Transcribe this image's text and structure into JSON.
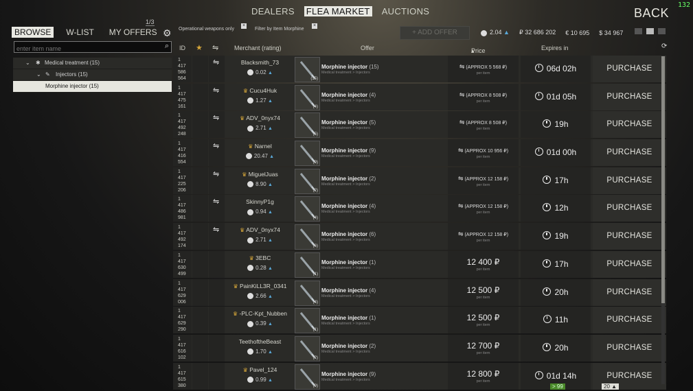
{
  "overlay": {
    "fps": "132"
  },
  "nav": {
    "tabs": [
      {
        "label": "DEALERS"
      },
      {
        "label": "FLEA MARKET"
      },
      {
        "label": "AUCTIONS"
      }
    ],
    "back_label": "BACK"
  },
  "left_tabs": {
    "browse": "BROWSE",
    "wlist": "W-LIST",
    "my_offers": "MY OFFERS",
    "page_count": "1/3"
  },
  "filters": {
    "operational": "Operational weapons only",
    "morphine": "Filter by Item Morphine"
  },
  "add_offer": "+ ADD OFFER",
  "balance": {
    "rating": "2.04",
    "roubles": "₽ 32 686 202",
    "euros": "€ 10 695",
    "dollars": "$ 34 967"
  },
  "search": {
    "placeholder": "enter item name"
  },
  "tree": {
    "medical": "Medical treatment (15)",
    "injectors": "Injectors (15)",
    "morphine": "Morphine injector (15)"
  },
  "headers": {
    "id": "ID",
    "merchant": "Merchant (rating)",
    "offer": "Offer",
    "price": "Price",
    "expires": "Expires in"
  },
  "offer_category": "Medical treatment > Injectors",
  "per_item": "per item",
  "purchase_label": "PURCHASE",
  "rows": [
    {
      "id": [
        "1",
        "417",
        "586",
        "564"
      ],
      "swap": true,
      "crown": false,
      "merchant": "Blacksmith_73",
      "rating": "0.02",
      "item": "Morphine injector",
      "count": "(15)",
      "price": "(APPROX 5 568 ₽)",
      "barter": true,
      "expires": "06d 02h"
    },
    {
      "id": [
        "1",
        "417",
        "475",
        "161"
      ],
      "swap": true,
      "crown": true,
      "merchant": "Cucu4Huk",
      "rating": "1.27",
      "item": "Morphine injector",
      "count": "(4)",
      "price": "(APPROX 8 508 ₽)",
      "barter": true,
      "expires": "01d 05h"
    },
    {
      "id": [
        "1",
        "417",
        "492",
        "248"
      ],
      "swap": true,
      "crown": true,
      "merchant": "ADV_0nyx74",
      "rating": "2.71",
      "item": "Morphine injector",
      "count": "(5)",
      "price": "(APPROX 8 508 ₽)",
      "barter": true,
      "expires": "19h"
    },
    {
      "id": [
        "1",
        "417",
        "416",
        "554"
      ],
      "swap": true,
      "crown": true,
      "merchant": "Narnel",
      "rating": "20.47",
      "item": "Morphine injector",
      "count": "(9)",
      "price": "(APPROX 10 956 ₽)",
      "barter": true,
      "expires": "01d 00h"
    },
    {
      "id": [
        "1",
        "417",
        "225",
        "206"
      ],
      "swap": true,
      "crown": true,
      "merchant": "MiguelJuas",
      "rating": "8.90",
      "item": "Morphine injector",
      "count": "(2)",
      "price": "(APPROX 12 158 ₽)",
      "barter": true,
      "expires": "17h"
    },
    {
      "id": [
        "1",
        "417",
        "486",
        "981"
      ],
      "swap": true,
      "crown": false,
      "merchant": "SkinnyP1g",
      "rating": "0.94",
      "item": "Morphine injector",
      "count": "(4)",
      "price": "(APPROX 12 158 ₽)",
      "barter": true,
      "expires": "12h"
    },
    {
      "id": [
        "1",
        "417",
        "492",
        "174"
      ],
      "swap": true,
      "crown": true,
      "merchant": "ADV_0nyx74",
      "rating": "2.71",
      "item": "Morphine injector",
      "count": "(6)",
      "price": "(APPROX 12 158 ₽)",
      "barter": true,
      "expires": "19h"
    },
    {
      "id": [
        "1",
        "417",
        "630",
        "499"
      ],
      "swap": false,
      "crown": true,
      "merchant": "3EBC",
      "rating": "0.28",
      "item": "Morphine injector",
      "count": "(1)",
      "price": "12 400 ₽",
      "barter": false,
      "expires": "17h"
    },
    {
      "id": [
        "1",
        "417",
        "629",
        "006"
      ],
      "swap": false,
      "crown": true,
      "merchant": "PainKiLL3R_0341",
      "rating": "2.66",
      "item": "Morphine injector",
      "count": "(4)",
      "price": "12 500 ₽",
      "barter": false,
      "expires": "20h"
    },
    {
      "id": [
        "1",
        "417",
        "629",
        "290"
      ],
      "swap": false,
      "crown": true,
      "merchant": "-PLC-Kpt_Nubben",
      "rating": "0.39",
      "item": "Morphine injector",
      "count": "(1)",
      "price": "12 500 ₽",
      "barter": false,
      "expires": "11h"
    },
    {
      "id": [
        "1",
        "417",
        "616",
        "102"
      ],
      "swap": false,
      "crown": false,
      "merchant": "TeethoftheBeast",
      "rating": "1.70",
      "item": "Morphine injector",
      "count": "(2)",
      "price": "12 700 ₽",
      "barter": false,
      "expires": "20h"
    },
    {
      "id": [
        "1",
        "417",
        "615",
        "380"
      ],
      "swap": false,
      "crown": true,
      "merchant": "Pavel_124",
      "rating": "0.99",
      "item": "Morphine injector",
      "count": "(9)",
      "price": "12 800 ₽",
      "barter": false,
      "expires": "01d 14h"
    }
  ],
  "badges": {
    "left": "> 99",
    "right": "20 ▲"
  }
}
